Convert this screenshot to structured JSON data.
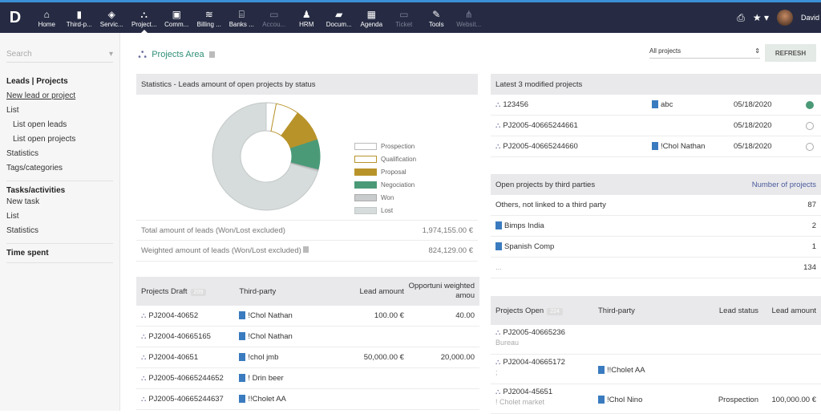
{
  "nav": {
    "items": [
      {
        "label": "Home",
        "icon": "home-icon",
        "glyph": "⌂"
      },
      {
        "label": "Third-p...",
        "icon": "building-icon",
        "glyph": "▮"
      },
      {
        "label": "Servic...",
        "icon": "cube-icon",
        "glyph": "◈"
      },
      {
        "label": "Project...",
        "icon": "sitemap-icon",
        "glyph": "⛬",
        "active": true
      },
      {
        "label": "Comm...",
        "icon": "briefcase-icon",
        "glyph": "▣"
      },
      {
        "label": "Billing ...",
        "icon": "coins-icon",
        "glyph": "≋"
      },
      {
        "label": "Banks ...",
        "icon": "bank-icon",
        "glyph": "⌸"
      },
      {
        "label": "Accou...",
        "icon": "money-icon",
        "glyph": "▭",
        "dim": true
      },
      {
        "label": "HRM",
        "icon": "user-tie-icon",
        "glyph": "♟"
      },
      {
        "label": "Docum...",
        "icon": "folder-icon",
        "glyph": "▰"
      },
      {
        "label": "Agenda",
        "icon": "calendar-icon",
        "glyph": "▦"
      },
      {
        "label": "Ticket",
        "icon": "ticket-icon",
        "glyph": "▭",
        "dim": true
      },
      {
        "label": "Tools",
        "icon": "wrench-icon",
        "glyph": "✎"
      },
      {
        "label": "Websit...",
        "icon": "network-icon",
        "glyph": "⋔",
        "dim": true
      }
    ],
    "user": "David"
  },
  "sidebar": {
    "search_placeholder": "Search",
    "section1": {
      "title": "Leads | Projects",
      "items": [
        "New lead or project",
        "List",
        "List open leads",
        "List open projects",
        "Statistics",
        "Tags/categories"
      ]
    },
    "section2": {
      "title": "Tasks/activities",
      "items": [
        "New task",
        "List",
        "Statistics"
      ]
    },
    "section3": {
      "title": "Time spent"
    }
  },
  "page": {
    "title": "Projects Area",
    "filter": "All projects",
    "refresh": "REFRESH"
  },
  "stats": {
    "title": "Statistics - Leads amount of open projects by status",
    "total_label": "Total amount of leads (Won/Lost excluded)",
    "total_value": "1,974,155.00 €",
    "weighted_label": "Weighted amount of leads (Won/Lost excluded)",
    "weighted_value": "824,129.00 €"
  },
  "chart_data": {
    "type": "pie",
    "title": "Leads amount of open projects by status",
    "labels": [
      "Prospection",
      "Qualification",
      "Proposal",
      "Negociation",
      "Won",
      "Lost"
    ],
    "values": [
      3,
      7,
      10,
      9,
      0.5,
      70.5
    ],
    "colors": [
      "#ffffff",
      "#ffffff",
      "#b8932a",
      "#4a9a78",
      "#c9cccd",
      "#d6dcdb"
    ],
    "strokes": [
      "#bbb",
      "#b8932a",
      "#b8932a",
      "#4a9a78",
      "#aaa",
      "#c2c8c7"
    ],
    "legend": "right"
  },
  "draft": {
    "title": "Projects Draft",
    "count": "209",
    "cols": [
      "Third-party",
      "Lead amount",
      "Opportuni weighted amou"
    ],
    "rows": [
      {
        "ref": "PJ2004-40652",
        "tp": "!Chol Nathan",
        "amount": "100.00 €",
        "weighted": "40.00"
      },
      {
        "ref": "PJ2004-40665165",
        "tp": "!Chol Nathan",
        "amount": "",
        "weighted": ""
      },
      {
        "ref": "PJ2004-40651",
        "tp": "!chol jmb",
        "amount": "50,000.00 €",
        "weighted": "20,000.00"
      },
      {
        "ref": "PJ2005-40665244652",
        "tp": "! Drin beer",
        "amount": "",
        "weighted": ""
      },
      {
        "ref": "PJ2005-40665244637",
        "tp": "!!Cholet AA",
        "amount": "",
        "weighted": ""
      }
    ]
  },
  "latest": {
    "title": "Latest 3 modified projects",
    "rows": [
      {
        "ref": "123456",
        "tp": "abc",
        "date": "05/18/2020",
        "status": "open"
      },
      {
        "ref": "PJ2005-40665244661",
        "tp": "",
        "date": "05/18/2020",
        "status": "draft"
      },
      {
        "ref": "PJ2005-40665244660",
        "tp": "!Chol Nathan",
        "date": "05/18/2020",
        "status": "draft"
      }
    ]
  },
  "bythird": {
    "title": "Open projects by third parties",
    "col": "Number of projects",
    "rows": [
      {
        "name": "Others, not linked to a third party",
        "count": "87",
        "tp": false
      },
      {
        "name": "Bimps India",
        "count": "2",
        "tp": true
      },
      {
        "name": "Spanish Comp",
        "count": "1",
        "tp": true
      },
      {
        "name": "...",
        "count": "134",
        "tp": false
      }
    ]
  },
  "open": {
    "title": "Projects Open",
    "count": "224",
    "cols": [
      "Third-party",
      "Lead status",
      "Lead amount"
    ],
    "rows": [
      {
        "ref": "PJ2005-40665236",
        "sub": "Bureau",
        "tp": "",
        "status": "",
        "amount": ""
      },
      {
        "ref": "PJ2004-40665172",
        "sub": ";",
        "tp": "!!Cholet AA",
        "status": "",
        "amount": ""
      },
      {
        "ref": "PJ2004-45651",
        "sub": "! Cholet market",
        "tp": "!Chol Nino",
        "status": "Prospection",
        "amount": "100,000.00 €"
      }
    ]
  }
}
